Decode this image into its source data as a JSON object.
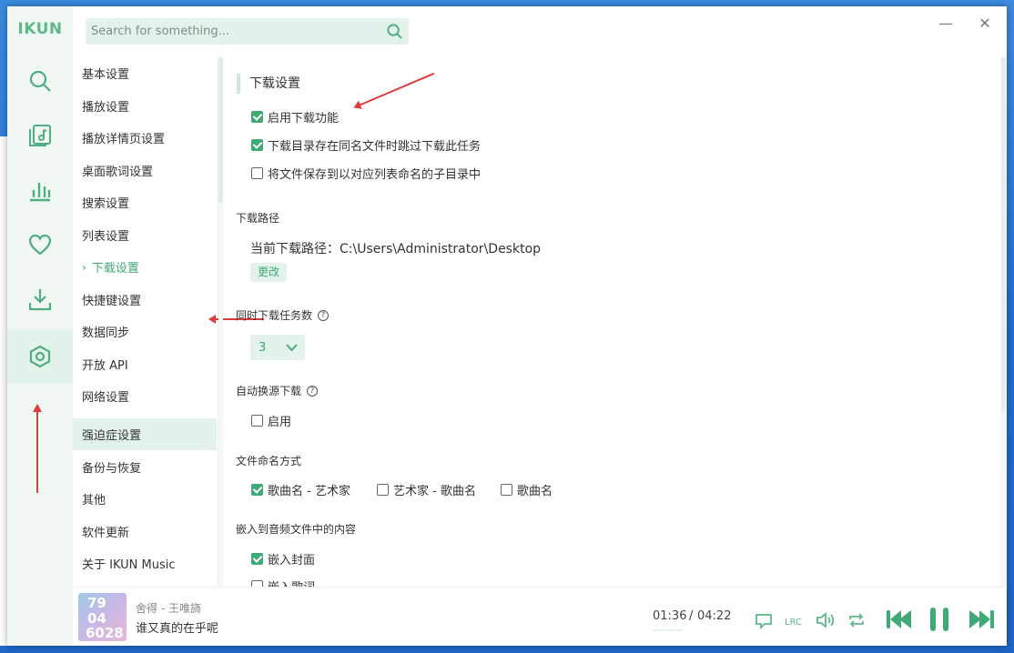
{
  "brand": "IKUN",
  "search": {
    "placeholder": "Search for something..."
  },
  "window": {
    "minimize": "—",
    "close": "✕"
  },
  "nav_items": [
    {
      "label": "基本设置"
    },
    {
      "label": "播放设置"
    },
    {
      "label": "播放详情页设置"
    },
    {
      "label": "桌面歌词设置"
    },
    {
      "label": "搜索设置"
    },
    {
      "label": "列表设置"
    },
    {
      "label": "下载设置",
      "active": true
    },
    {
      "label": "快捷键设置"
    },
    {
      "label": "数据同步"
    },
    {
      "label": "开放 API"
    },
    {
      "label": "网络设置"
    },
    {
      "label": "强迫症设置",
      "highlight": true
    },
    {
      "label": "备份与恢复"
    },
    {
      "label": "其他"
    },
    {
      "label": "软件更新"
    },
    {
      "label": "关于 IKUN Music"
    }
  ],
  "nav_active_marker": "›",
  "download": {
    "section_title": "下载设置",
    "options": [
      {
        "label": "启用下载功能",
        "checked": true
      },
      {
        "label": "下载目录存在同名文件时跳过下载此任务",
        "checked": true
      },
      {
        "label": "将文件保存到以对应列表命名的子目录中",
        "checked": false
      }
    ],
    "path_label": "下载路径",
    "current_path_text": "当前下载路径：C:\\Users\\Administrator\\Desktop",
    "change_button": "更改",
    "concurrent_label": "同时下载任务数",
    "concurrent_value": "3",
    "auto_source_label": "自动换源下载",
    "auto_source_enable": {
      "label": "启用",
      "checked": false
    },
    "naming_label": "文件命名方式",
    "naming_options": [
      {
        "label": "歌曲名 - 艺术家",
        "checked": true
      },
      {
        "label": "艺术家 - 歌曲名",
        "checked": false
      },
      {
        "label": "歌曲名",
        "checked": false
      }
    ],
    "embed_label": "嵌入到音频文件中的内容",
    "embed_options": [
      {
        "label": "嵌入封面",
        "checked": true
      },
      {
        "label": "嵌入歌词",
        "checked": false
      }
    ],
    "help_glyph": "?"
  },
  "player": {
    "track_sub": "舍得 - 王唯旖",
    "track_title": "谁又真的在乎呢",
    "time_current": "01:36",
    "time_sep": "/",
    "time_total": "04:22",
    "cover_text": [
      "79",
      "04",
      "6028"
    ],
    "lrc_label": "LRC"
  },
  "colors": {
    "accent": "#3faa75",
    "accent_light": "#e3f2ea",
    "annotation": "#e03b3b"
  }
}
